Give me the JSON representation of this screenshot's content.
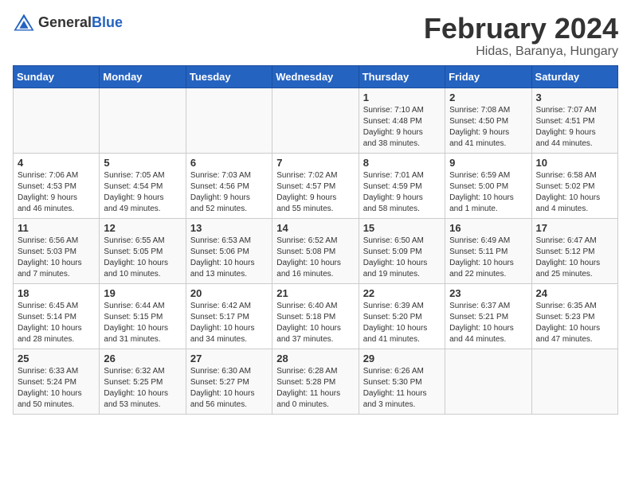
{
  "header": {
    "logo_general": "General",
    "logo_blue": "Blue",
    "title": "February 2024",
    "subtitle": "Hidas, Baranya, Hungary"
  },
  "calendar": {
    "days_of_week": [
      "Sunday",
      "Monday",
      "Tuesday",
      "Wednesday",
      "Thursday",
      "Friday",
      "Saturday"
    ],
    "weeks": [
      [
        {
          "day": "",
          "info": ""
        },
        {
          "day": "",
          "info": ""
        },
        {
          "day": "",
          "info": ""
        },
        {
          "day": "",
          "info": ""
        },
        {
          "day": "1",
          "info": "Sunrise: 7:10 AM\nSunset: 4:48 PM\nDaylight: 9 hours\nand 38 minutes."
        },
        {
          "day": "2",
          "info": "Sunrise: 7:08 AM\nSunset: 4:50 PM\nDaylight: 9 hours\nand 41 minutes."
        },
        {
          "day": "3",
          "info": "Sunrise: 7:07 AM\nSunset: 4:51 PM\nDaylight: 9 hours\nand 44 minutes."
        }
      ],
      [
        {
          "day": "4",
          "info": "Sunrise: 7:06 AM\nSunset: 4:53 PM\nDaylight: 9 hours\nand 46 minutes."
        },
        {
          "day": "5",
          "info": "Sunrise: 7:05 AM\nSunset: 4:54 PM\nDaylight: 9 hours\nand 49 minutes."
        },
        {
          "day": "6",
          "info": "Sunrise: 7:03 AM\nSunset: 4:56 PM\nDaylight: 9 hours\nand 52 minutes."
        },
        {
          "day": "7",
          "info": "Sunrise: 7:02 AM\nSunset: 4:57 PM\nDaylight: 9 hours\nand 55 minutes."
        },
        {
          "day": "8",
          "info": "Sunrise: 7:01 AM\nSunset: 4:59 PM\nDaylight: 9 hours\nand 58 minutes."
        },
        {
          "day": "9",
          "info": "Sunrise: 6:59 AM\nSunset: 5:00 PM\nDaylight: 10 hours\nand 1 minute."
        },
        {
          "day": "10",
          "info": "Sunrise: 6:58 AM\nSunset: 5:02 PM\nDaylight: 10 hours\nand 4 minutes."
        }
      ],
      [
        {
          "day": "11",
          "info": "Sunrise: 6:56 AM\nSunset: 5:03 PM\nDaylight: 10 hours\nand 7 minutes."
        },
        {
          "day": "12",
          "info": "Sunrise: 6:55 AM\nSunset: 5:05 PM\nDaylight: 10 hours\nand 10 minutes."
        },
        {
          "day": "13",
          "info": "Sunrise: 6:53 AM\nSunset: 5:06 PM\nDaylight: 10 hours\nand 13 minutes."
        },
        {
          "day": "14",
          "info": "Sunrise: 6:52 AM\nSunset: 5:08 PM\nDaylight: 10 hours\nand 16 minutes."
        },
        {
          "day": "15",
          "info": "Sunrise: 6:50 AM\nSunset: 5:09 PM\nDaylight: 10 hours\nand 19 minutes."
        },
        {
          "day": "16",
          "info": "Sunrise: 6:49 AM\nSunset: 5:11 PM\nDaylight: 10 hours\nand 22 minutes."
        },
        {
          "day": "17",
          "info": "Sunrise: 6:47 AM\nSunset: 5:12 PM\nDaylight: 10 hours\nand 25 minutes."
        }
      ],
      [
        {
          "day": "18",
          "info": "Sunrise: 6:45 AM\nSunset: 5:14 PM\nDaylight: 10 hours\nand 28 minutes."
        },
        {
          "day": "19",
          "info": "Sunrise: 6:44 AM\nSunset: 5:15 PM\nDaylight: 10 hours\nand 31 minutes."
        },
        {
          "day": "20",
          "info": "Sunrise: 6:42 AM\nSunset: 5:17 PM\nDaylight: 10 hours\nand 34 minutes."
        },
        {
          "day": "21",
          "info": "Sunrise: 6:40 AM\nSunset: 5:18 PM\nDaylight: 10 hours\nand 37 minutes."
        },
        {
          "day": "22",
          "info": "Sunrise: 6:39 AM\nSunset: 5:20 PM\nDaylight: 10 hours\nand 41 minutes."
        },
        {
          "day": "23",
          "info": "Sunrise: 6:37 AM\nSunset: 5:21 PM\nDaylight: 10 hours\nand 44 minutes."
        },
        {
          "day": "24",
          "info": "Sunrise: 6:35 AM\nSunset: 5:23 PM\nDaylight: 10 hours\nand 47 minutes."
        }
      ],
      [
        {
          "day": "25",
          "info": "Sunrise: 6:33 AM\nSunset: 5:24 PM\nDaylight: 10 hours\nand 50 minutes."
        },
        {
          "day": "26",
          "info": "Sunrise: 6:32 AM\nSunset: 5:25 PM\nDaylight: 10 hours\nand 53 minutes."
        },
        {
          "day": "27",
          "info": "Sunrise: 6:30 AM\nSunset: 5:27 PM\nDaylight: 10 hours\nand 56 minutes."
        },
        {
          "day": "28",
          "info": "Sunrise: 6:28 AM\nSunset: 5:28 PM\nDaylight: 11 hours\nand 0 minutes."
        },
        {
          "day": "29",
          "info": "Sunrise: 6:26 AM\nSunset: 5:30 PM\nDaylight: 11 hours\nand 3 minutes."
        },
        {
          "day": "",
          "info": ""
        },
        {
          "day": "",
          "info": ""
        }
      ]
    ]
  }
}
